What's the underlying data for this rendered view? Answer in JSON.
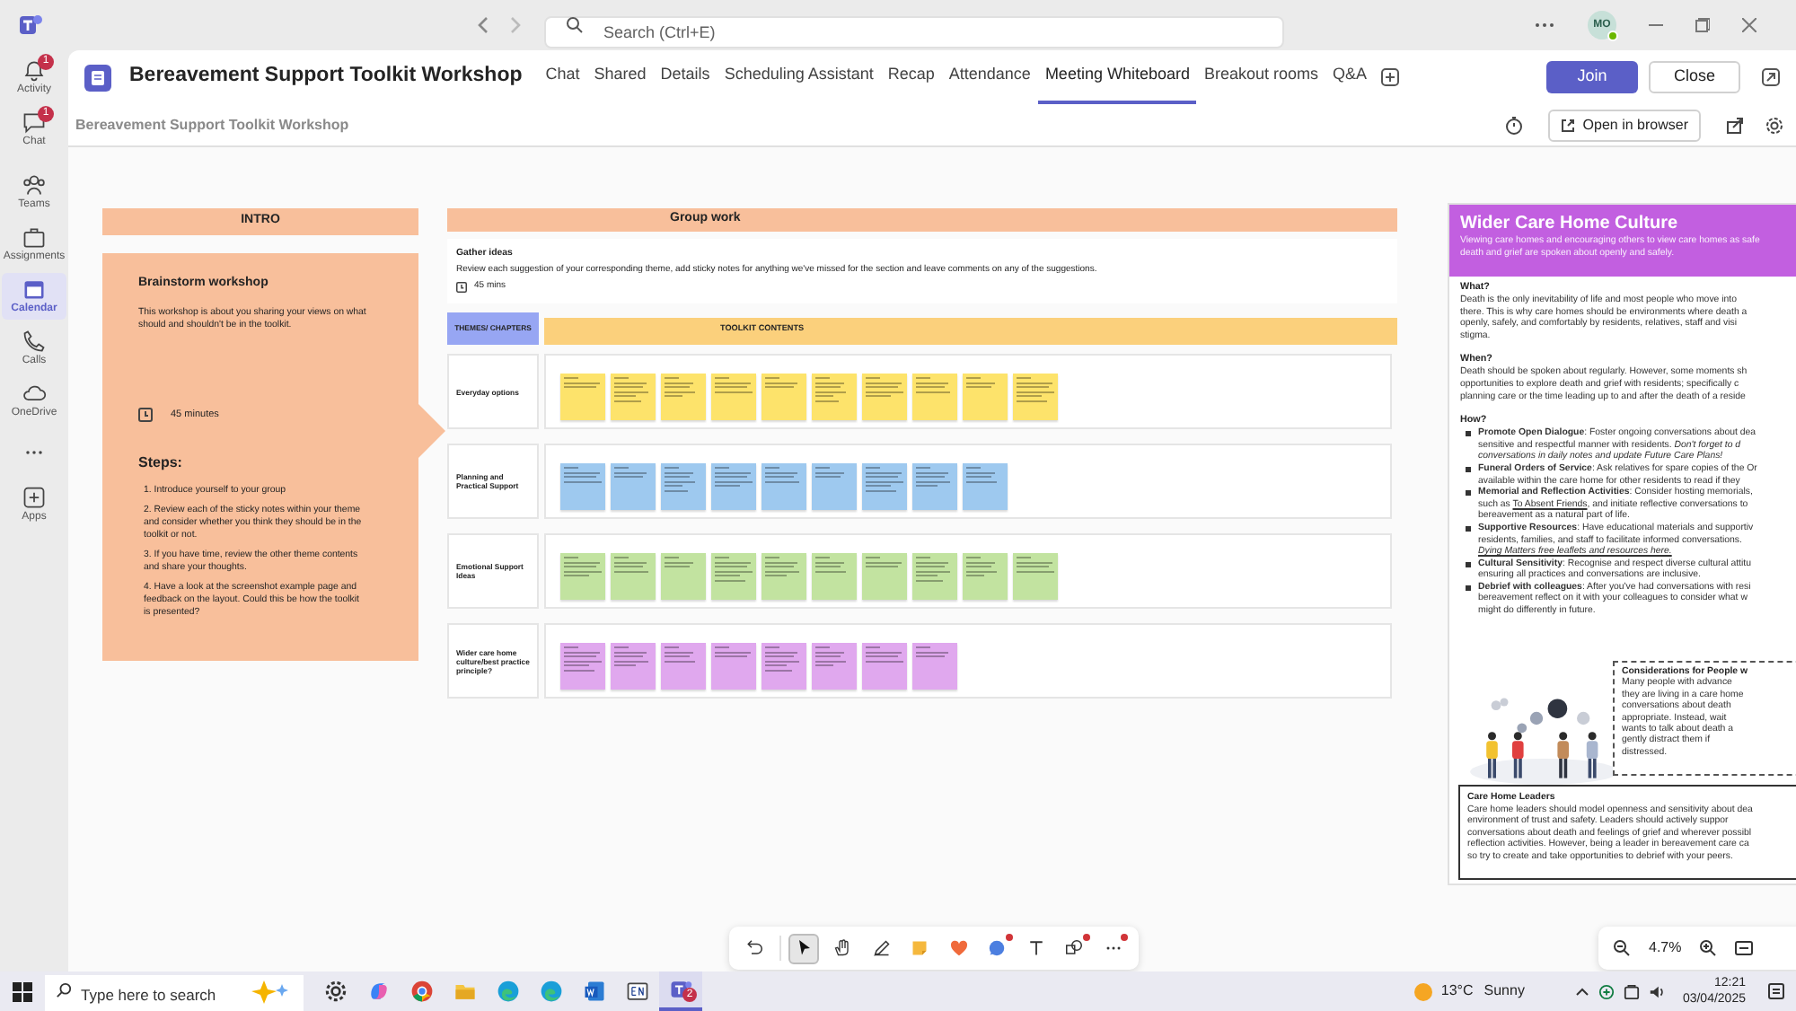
{
  "app_bar": {
    "search_placeholder": "Search (Ctrl+E)",
    "avatar": "MO"
  },
  "rail": [
    {
      "label": "Activity",
      "badge": "1",
      "selected": false,
      "kind": "bell"
    },
    {
      "label": "Chat",
      "badge": "1",
      "selected": false,
      "kind": "chat"
    },
    {
      "label": "Teams",
      "selected": false,
      "kind": "teams"
    },
    {
      "label": "Assignments",
      "selected": false,
      "kind": "bag"
    },
    {
      "label": "Calendar",
      "selected": true,
      "kind": "calendar"
    },
    {
      "label": "Calls",
      "selected": false,
      "kind": "phone"
    },
    {
      "label": "OneDrive",
      "selected": false,
      "kind": "cloud"
    },
    {
      "label": "Apps",
      "selected": false,
      "kind": "plus"
    }
  ],
  "meeting": {
    "title": "Bereavement Support Toolkit Workshop",
    "tabs": [
      {
        "label": "Chat",
        "selected": false
      },
      {
        "label": "Shared",
        "selected": false
      },
      {
        "label": "Details",
        "selected": false
      },
      {
        "label": "Scheduling Assistant",
        "selected": false
      },
      {
        "label": "Recap",
        "selected": false
      },
      {
        "label": "Attendance",
        "selected": false
      },
      {
        "label": "Meeting Whiteboard",
        "selected": true
      },
      {
        "label": "Breakout rooms",
        "selected": false
      },
      {
        "label": "Q&A",
        "selected": false
      }
    ],
    "join": "Join",
    "close": "Close"
  },
  "whiteboard_bar": {
    "title": "Bereavement Support Toolkit Workshop",
    "open_button": "Open in browser"
  },
  "intro": {
    "header": "INTRO",
    "title": "Brainstorm workshop",
    "description": "This workshop is about you sharing your views on what should and shouldn't be in the toolkit.",
    "duration": "45 minutes",
    "steps_title": "Steps:",
    "steps": [
      "1. Introduce yourself to your group",
      "2. Review each of the sticky notes within your theme and consider whether you think they should be in the toolkit or not.",
      "3. If you have time, review the other theme contents and share your thoughts.",
      "4. Have a look at the screenshot example page and feedback on the layout. Could this be how the toolkit is presented?"
    ]
  },
  "group": {
    "header": "Group work",
    "gather_title": "Gather ideas",
    "gather_text": "Review each suggestion of your corresponding theme, add sticky notes for anything we've missed for the section and leave comments on any of the suggestions.",
    "duration": "45 mins",
    "themes_label": "THEMES/ CHAPTERS",
    "contents_label": "TOOLKIT CONTENTS",
    "rows": [
      {
        "theme": "Everyday options",
        "color": "#fde36b",
        "notes": [
          {
            "kind": "sticky"
          },
          {
            "kind": "sticky"
          },
          {
            "kind": "sticky"
          },
          {
            "kind": "sticky"
          },
          {
            "kind": "sticky"
          },
          {
            "kind": "sticky"
          },
          {
            "kind": "sticky"
          },
          {
            "kind": "sticky"
          },
          {
            "kind": "sticky"
          },
          {
            "kind": "sticky"
          }
        ]
      },
      {
        "theme": "Planning and Practical Support",
        "color": "#9ec9ef",
        "notes": [
          {
            "kind": "sticky"
          },
          {
            "kind": "sticky"
          },
          {
            "kind": "sticky"
          },
          {
            "kind": "sticky"
          },
          {
            "kind": "sticky"
          },
          {
            "kind": "sticky"
          },
          {
            "kind": "sticky"
          },
          {
            "kind": "sticky"
          },
          {
            "kind": "sticky"
          }
        ]
      },
      {
        "theme": "Emotional Support Ideas",
        "color": "#c2e3a0",
        "notes": [
          {
            "kind": "sticky"
          },
          {
            "kind": "sticky"
          },
          {
            "kind": "sticky"
          },
          {
            "kind": "sticky"
          },
          {
            "kind": "sticky"
          },
          {
            "kind": "sticky"
          },
          {
            "kind": "sticky"
          },
          {
            "kind": "sticky"
          },
          {
            "kind": "sticky"
          },
          {
            "kind": "sticky"
          }
        ]
      },
      {
        "theme": "Wider care home culture/best practice principle?",
        "color": "#e0a8ee",
        "notes": [
          {
            "kind": "sticky"
          },
          {
            "kind": "sticky"
          },
          {
            "kind": "sticky"
          },
          {
            "kind": "sticky"
          },
          {
            "kind": "sticky"
          },
          {
            "kind": "sticky"
          },
          {
            "kind": "sticky"
          },
          {
            "kind": "sticky"
          }
        ]
      }
    ]
  },
  "culture": {
    "title": "Wider Care Home Culture",
    "subtitle": [
      "Viewing care homes and encouraging others to view care homes as safe",
      "death and grief are spoken about openly and safely."
    ],
    "sections": [
      {
        "heading": "What?",
        "paragraphs": [
          [
            {
              "text": "Death is the only inevitability of life and most people who move into"
            },
            {
              "text": "there. This is why care homes should be environments where death a"
            },
            {
              "text": "openly, safely, and comfortably by residents, relatives, staff and visi"
            },
            {
              "text": "stigma."
            }
          ]
        ]
      },
      {
        "heading": "When?",
        "paragraphs": [
          [
            {
              "text": "Death should be spoken about regularly. However, some moments sh"
            },
            {
              "text": "opportunities to explore death and grief with residents; specifically c"
            },
            {
              "text": "planning care or the time leading up to and after the death of a reside"
            }
          ]
        ]
      },
      {
        "heading": "How?",
        "bullets": true,
        "paragraphs": [
          [
            {
              "text": "**Promote Open Dialogue**: Foster ongoing conversations about dea"
            },
            {
              "text": "sensitive and respectful manner with residents. *Don't forget to d*"
            },
            {
              "text": "*conversations in daily notes and update Future Care Plans!*"
            }
          ],
          [
            {
              "text": "**Funeral Orders of Service**: Ask relatives for spare copies of the Or"
            },
            {
              "text": "available within the care home for other residents to read if they"
            }
          ],
          [
            {
              "text": "**Memorial and Reflection Activities**: Consider hosting memorials,"
            },
            {
              "text": "such as ",
              "link": "To Absent Friends",
              "after": ", and initiate reflective conversations to"
            },
            {
              "text": "bereavement as a natural part of life."
            }
          ],
          [
            {
              "text": "**Supportive Resources**: Have educational materials and supportiv"
            },
            {
              "text": "residents, families, and staff to facilitate informed conversations."
            },
            {
              "link": "Dying Matters free leaflets and resources here."
            }
          ],
          [
            {
              "text": "**Cultural Sensitivity**: Recognise and respect diverse cultural attitu"
            },
            {
              "text": "ensuring all practices and conversations are inclusive."
            }
          ],
          [
            {
              "text": "**Debrief with colleagues**: After you've had conversations with resi"
            },
            {
              "text": "bereavement reflect on it with your colleagues to consider what w"
            },
            {
              "text": "might do differently in future."
            }
          ]
        ]
      }
    ],
    "considerations": {
      "title": "Considerations for People w",
      "lines": [
        "Many people with advance",
        "they are living in a care home",
        "conversations about death",
        "appropriate. Instead, wait",
        "wants to talk about death a",
        "gently distract them if",
        "distressed."
      ]
    },
    "leaders": {
      "title": "Care Home Leaders",
      "lines": [
        "Care home leaders should model openness and sensitivity about dea",
        "environment of trust and safety. Leaders should actively suppor",
        "conversations about death and feelings of grief and wherever possibl",
        "reflection activities. However, being a leader in bereavement care ca",
        "so try to create and take opportunities to debrief with your peers."
      ]
    }
  },
  "tools": [
    {
      "kind": "undo",
      "selected": false,
      "notification": false
    },
    {
      "kind": "pointer",
      "selected": true,
      "notification": false
    },
    {
      "kind": "hand",
      "selected": false,
      "notification": false
    },
    {
      "kind": "pen",
      "selected": false,
      "notification": false
    },
    {
      "kind": "note",
      "selected": false,
      "notification": false
    },
    {
      "kind": "heart",
      "selected": false,
      "notification": false
    },
    {
      "kind": "bubble",
      "selected": false,
      "notification": true
    },
    {
      "kind": "text",
      "selected": false,
      "notification": false
    },
    {
      "kind": "shapes",
      "selected": false,
      "notification": true
    },
    {
      "kind": "more",
      "selected": false,
      "notification": true
    }
  ],
  "zoom": {
    "value": "4.7%"
  },
  "taskbar": {
    "search_placeholder": "Type here to search",
    "apps": [
      {
        "kind": "gear"
      },
      {
        "kind": "copilot"
      },
      {
        "kind": "chrome"
      },
      {
        "kind": "folder"
      },
      {
        "kind": "edge"
      },
      {
        "kind": "edge"
      },
      {
        "kind": "word"
      },
      {
        "kind": "en"
      },
      {
        "kind": "teams",
        "badge": "2"
      }
    ],
    "temperature": "13°C",
    "weather": "Sunny",
    "time": "12:21",
    "date": "03/04/2025"
  }
}
